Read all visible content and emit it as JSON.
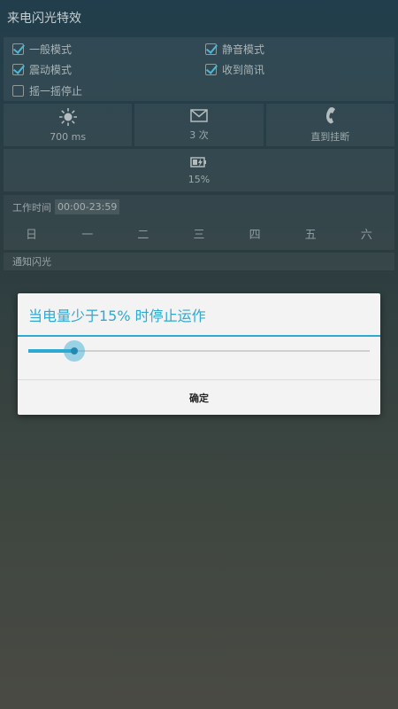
{
  "app": {
    "title": "来电闪光特效"
  },
  "modes": [
    {
      "label": "一般模式",
      "checked": true
    },
    {
      "label": "静音模式",
      "checked": true
    },
    {
      "label": "震动模式",
      "checked": true
    },
    {
      "label": "收到简讯",
      "checked": true
    },
    {
      "label": "摇一摇停止",
      "checked": false
    }
  ],
  "tiles": {
    "flash_speed": "700 ms",
    "flash_count": "3 次",
    "duration": "直到挂断"
  },
  "battery": {
    "value": "15%"
  },
  "worktime": {
    "label": "工作时间",
    "start": "00:00",
    "separator": "-",
    "end": "23:59",
    "days": [
      "日",
      "一",
      "二",
      "三",
      "四",
      "五",
      "六"
    ]
  },
  "notify": {
    "label": "通知闪光"
  },
  "dialog": {
    "title": "当电量少于15% 时停止运作",
    "slider_value_fraction": 0.135,
    "ok_label": "确定"
  },
  "colors": {
    "accent": "#2ea9d2"
  }
}
